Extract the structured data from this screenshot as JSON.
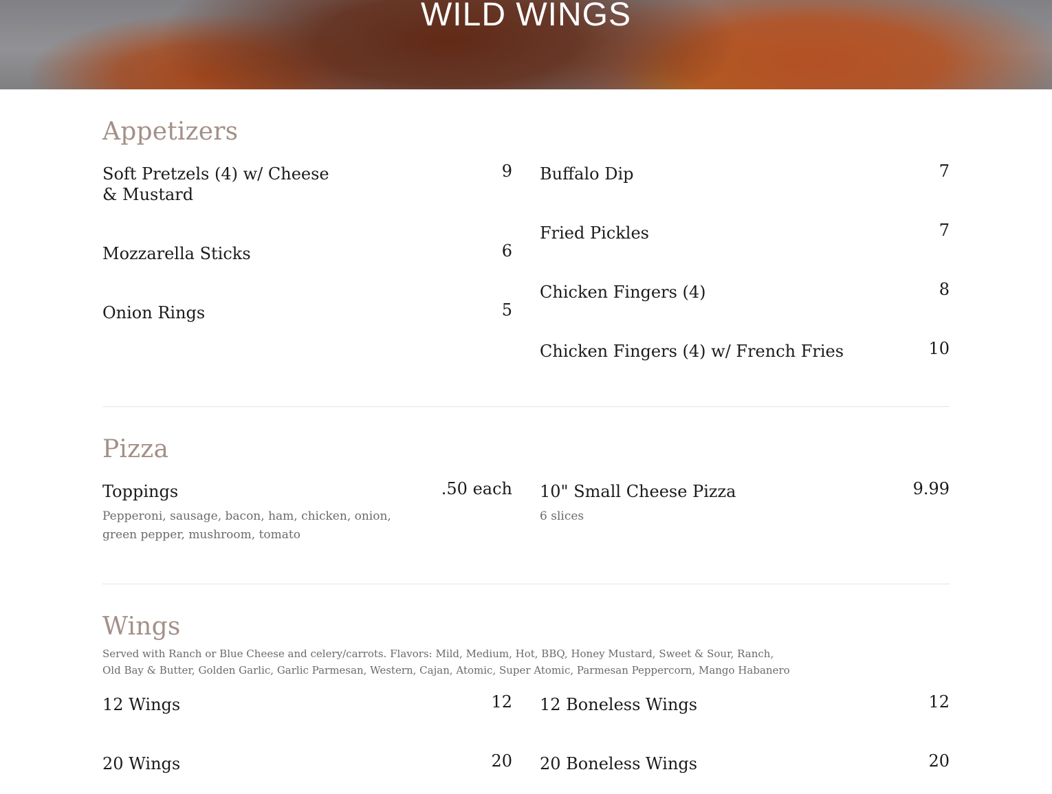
{
  "hero": {
    "title": "WILD WINGS"
  },
  "sections": [
    {
      "title": "Appetizers",
      "items": [
        {
          "name": "Soft Pretzels (4) w/ Cheese & Mustard",
          "price": "9"
        },
        {
          "name": "Mozzarella Sticks",
          "price": "6"
        },
        {
          "name": "Onion Rings",
          "price": "5"
        },
        {
          "name": "Buffalo Dip",
          "price": "7"
        },
        {
          "name": "Fried Pickles",
          "price": "7"
        },
        {
          "name": "Chicken Fingers (4)",
          "price": "8"
        },
        {
          "name": "Chicken Fingers (4) w/ French Fries",
          "price": "10"
        }
      ]
    },
    {
      "title": "Pizza",
      "items": [
        {
          "name": "Toppings",
          "price": ".50 each",
          "description": "Pepperoni, sausage, bacon, ham, chicken, onion, green pepper, mushroom, tomato"
        },
        {
          "name": "10\" Small Cheese Pizza",
          "price": "9.99",
          "description": "6 slices"
        }
      ]
    },
    {
      "title": "Wings",
      "description": "Served with Ranch or Blue Cheese and celery/carrots. Flavors: Mild, Medium, Hot, BBQ, Honey Mustard, Sweet & Sour, Ranch, Old Bay & Butter, Golden Garlic, Garlic Parmesan, Western, Cajan, Atomic, Super Atomic, Parmesan Peppercorn, Mango Habanero",
      "items": [
        {
          "name": "12 Wings",
          "price": "12"
        },
        {
          "name": "20 Wings",
          "price": "20"
        },
        {
          "name": "12 Boneless Wings",
          "price": "12"
        },
        {
          "name": "20 Boneless Wings",
          "price": "20"
        }
      ]
    }
  ]
}
